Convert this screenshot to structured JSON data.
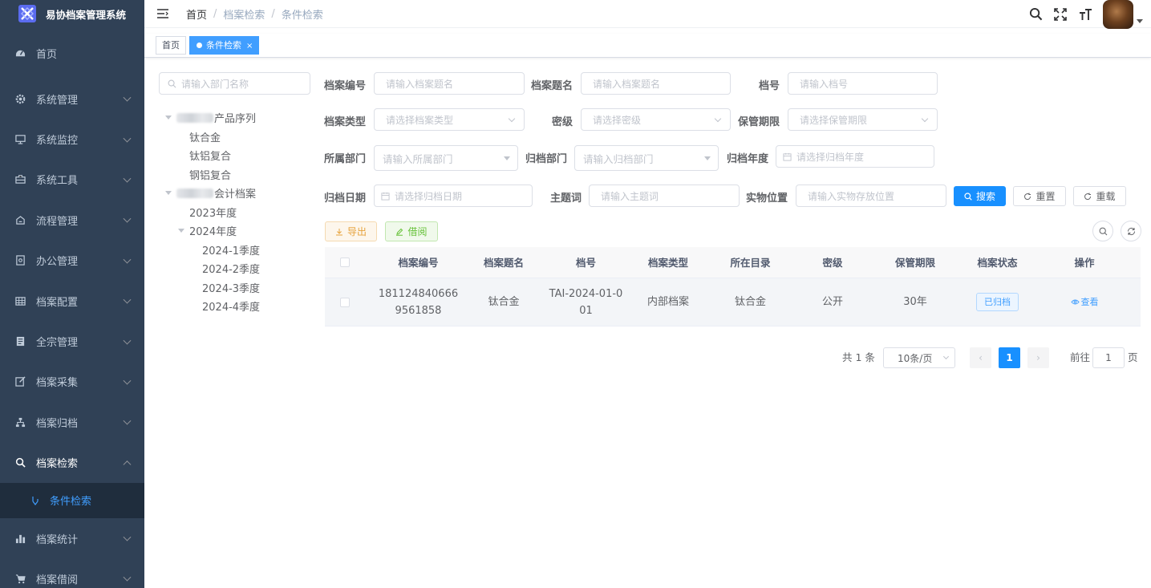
{
  "app": {
    "title": "易协档案管理系统"
  },
  "sidebar": {
    "items": [
      {
        "label": "首页",
        "icon": "dashboard-icon"
      },
      {
        "label": "系统管理",
        "icon": "gear-icon"
      },
      {
        "label": "系统监控",
        "icon": "monitor-icon"
      },
      {
        "label": "系统工具",
        "icon": "toolbox-icon"
      },
      {
        "label": "流程管理",
        "icon": "flow-icon"
      },
      {
        "label": "办公管理",
        "icon": "office-icon"
      },
      {
        "label": "档案配置",
        "icon": "table-icon"
      },
      {
        "label": "全宗管理",
        "icon": "document-icon"
      },
      {
        "label": "档案采集",
        "icon": "edit-icon"
      },
      {
        "label": "档案归档",
        "icon": "tree-icon"
      },
      {
        "label": "档案检索",
        "icon": "search-icon"
      },
      {
        "label": "档案统计",
        "icon": "bar-chart-icon"
      },
      {
        "label": "档案借阅",
        "icon": "cart-icon"
      }
    ],
    "active_sub": "条件检索"
  },
  "breadcrumb": {
    "home": "首页",
    "level1": "档案检索",
    "level2": "条件检索"
  },
  "tags": {
    "home": "首页",
    "active": "条件检索",
    "close": "×"
  },
  "dept": {
    "placeholder": "请输入部门名称",
    "tree": {
      "group1_label": "产品序列",
      "group1_children": [
        "钛合金",
        "钛铝复合",
        "钢铝复合"
      ],
      "group2_label": "会计档案",
      "year2023": "2023年度",
      "year2024": "2024年度",
      "quarters": [
        "2024-1季度",
        "2024-2季度",
        "2024-3季度",
        "2024-4季度"
      ]
    }
  },
  "form": {
    "archive_no": {
      "label": "档案编号",
      "placeholder": "请输入档案题名"
    },
    "archive_title": {
      "label": "档案题名",
      "placeholder": "请输入档案题名"
    },
    "file_no": {
      "label": "档号",
      "placeholder": "请输入档号"
    },
    "archive_type": {
      "label": "档案类型",
      "placeholder": "请选择档案类型"
    },
    "secret": {
      "label": "密级",
      "placeholder": "请选择密级"
    },
    "retention": {
      "label": "保管期限",
      "placeholder": "请选择保管期限"
    },
    "owner_dept": {
      "label": "所属部门",
      "placeholder": "请输入所属部门"
    },
    "archive_dept": {
      "label": "归档部门",
      "placeholder": "请输入归档部门"
    },
    "archive_year": {
      "label": "归档年度",
      "placeholder": "请选择归档年度"
    },
    "archive_date": {
      "label": "归档日期",
      "placeholder": "请选择归档日期"
    },
    "keyword": {
      "label": "主题词",
      "placeholder": "请输入主题词"
    },
    "location": {
      "label": "实物位置",
      "placeholder": "请输入实物存放位置"
    }
  },
  "buttons": {
    "search": "搜索",
    "reset": "重置",
    "reload": "重载",
    "export": "导出",
    "borrow": "借阅"
  },
  "table": {
    "columns": [
      "档案编号",
      "档案题名",
      "档号",
      "档案类型",
      "所在目录",
      "密级",
      "保管期限",
      "档案状态",
      "操作"
    ],
    "rows": [
      {
        "archive_no_l1": "181124840666",
        "archive_no_l2": "9561858",
        "title": "钛合金",
        "file_no_l1": "TAI-2024-01-0",
        "file_no_l2": "01",
        "type": "内部档案",
        "directory": "钛合金",
        "secret": "公开",
        "retention": "30年",
        "status": "已归档",
        "action": "查看"
      }
    ]
  },
  "pagination": {
    "total": "共 1 条",
    "page_size": "10条/页",
    "current": "1",
    "goto_label": "前往",
    "goto_value": "1",
    "page_unit": "页"
  }
}
